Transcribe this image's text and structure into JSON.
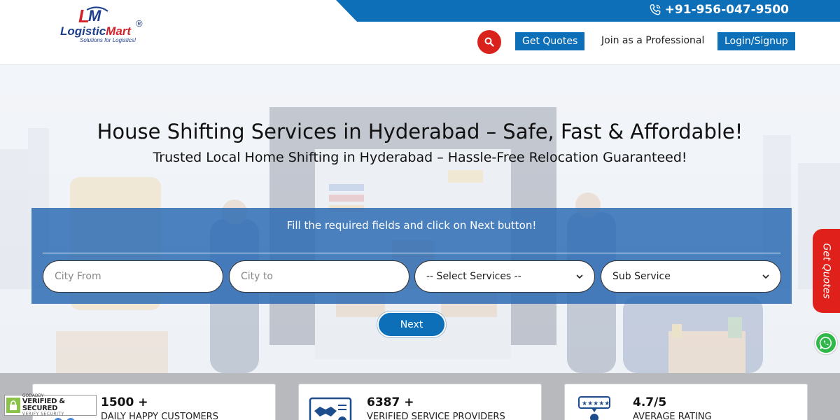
{
  "header": {
    "phone": "+91-956-047-9500",
    "logo": {
      "brand_a": "Logistic",
      "brand_b": "Mart",
      "reg": "®",
      "tagline": "Solutions for Logistics!"
    },
    "get_quotes": "Get Quotes",
    "join": "Join as a Professional",
    "login": "Login/Signup",
    "icons": {
      "search": "search-icon",
      "phone": "phone-icon"
    },
    "colors": {
      "primary": "#0d6fb8",
      "accent": "#d9221c"
    }
  },
  "hero": {
    "title": "House Shifting Services in Hyderabad – Safe, Fast & Affordable!",
    "subtitle": "Trusted Local Home Shifting in Hyderabad – Hassle-Free Relocation Guaranteed!"
  },
  "form": {
    "message": "Fill the required fields and click on Next button!",
    "city_from_placeholder": "City From",
    "city_to_placeholder": "City to",
    "services_selected": "-- Select Services --",
    "sub_service_selected": "Sub Service",
    "next": "Next"
  },
  "stats": [
    {
      "value": "1500 +",
      "label": "DAILY HAPPY CUSTOMERS"
    },
    {
      "value": "6387 +",
      "label": "VERIFIED SERVICE PROVIDERS"
    },
    {
      "value": "4.7/5",
      "label": "AVERAGE RATING"
    }
  ],
  "side": {
    "get_quotes": "Get Quotes"
  },
  "badge": {
    "line1": "GODADDY",
    "line2": "VERIFIED & SECURED",
    "line3": "VERIFY SECURITY"
  }
}
